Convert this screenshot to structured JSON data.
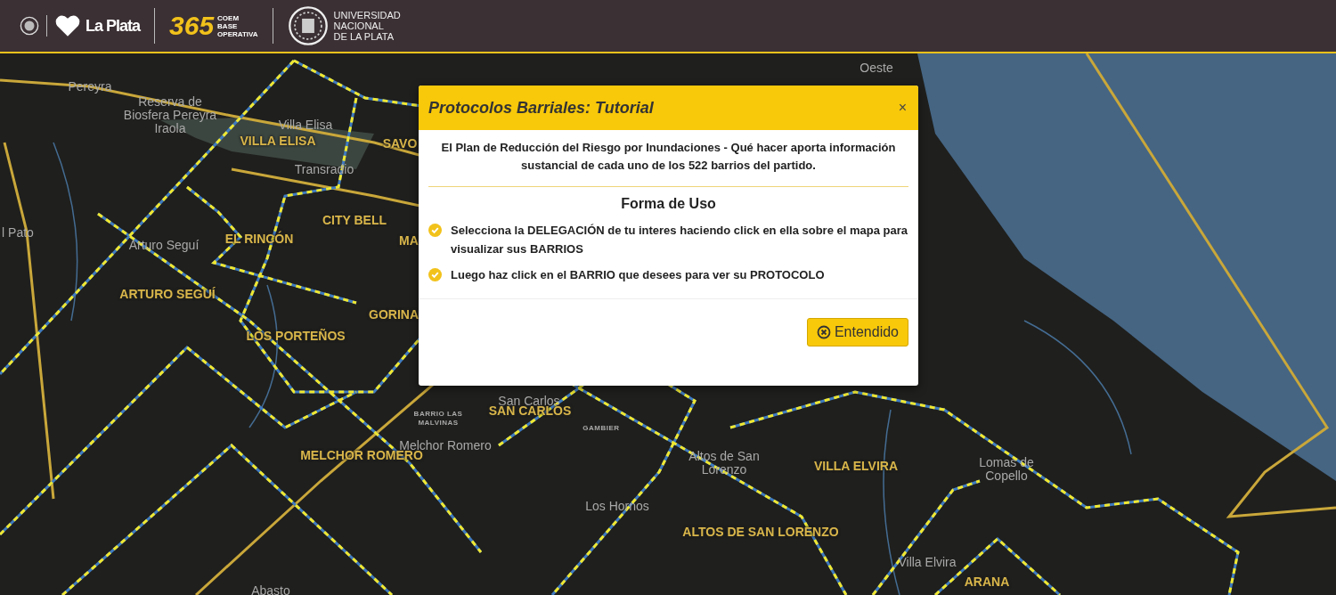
{
  "header": {
    "city_logo": {
      "text": "La Plata"
    },
    "coem_logo": {
      "number": "365",
      "lines": [
        "COEM",
        "BASE",
        "OPERATIVA"
      ]
    },
    "university_logo": {
      "lines": [
        "UNIVERSIDAD",
        "NACIONAL",
        "DE LA PLATA"
      ]
    }
  },
  "map": {
    "labels": [
      {
        "kind": "place",
        "text": "Oeste"
      },
      {
        "kind": "place",
        "text": "Pereyra"
      },
      {
        "kind": "place",
        "text": "Reserva de Biosfera Pereyra Iraola"
      },
      {
        "kind": "place",
        "text": "Villa Elisa"
      },
      {
        "kind": "delegation",
        "text": "VILLA ELISA"
      },
      {
        "kind": "delegation",
        "text": "SAVO"
      },
      {
        "kind": "place",
        "text": "Transradio"
      },
      {
        "kind": "delegation",
        "text": "CITY BELL"
      },
      {
        "kind": "place",
        "text": "l Pato"
      },
      {
        "kind": "place",
        "text": "Arturo Seguí"
      },
      {
        "kind": "delegation",
        "text": "EL RINCÓN"
      },
      {
        "kind": "delegation",
        "text": "MA"
      },
      {
        "kind": "delegation",
        "text": "ARTURO SEGUÍ"
      },
      {
        "kind": "delegation",
        "text": "GORINA"
      },
      {
        "kind": "delegation",
        "text": "LOS PORTEÑOS"
      },
      {
        "kind": "place",
        "text": "San Carlos"
      },
      {
        "kind": "small",
        "text": "BARRIO LAS MALVINAS"
      },
      {
        "kind": "delegation",
        "text": "SAN CARLOS"
      },
      {
        "kind": "small",
        "text": "GAMBIER"
      },
      {
        "kind": "delegation",
        "text": "MELCHOR ROMERO"
      },
      {
        "kind": "place",
        "text": "Melchor Romero"
      },
      {
        "kind": "place",
        "text": "Altos de San Lorenzo"
      },
      {
        "kind": "delegation",
        "text": "VILLA ELVIRA"
      },
      {
        "kind": "place",
        "text": "Lomas de Copello"
      },
      {
        "kind": "place",
        "text": "Los Hornos"
      },
      {
        "kind": "delegation",
        "text": "ALTOS DE SAN LORENZO"
      },
      {
        "kind": "place",
        "text": "Villa Elvira"
      },
      {
        "kind": "delegation",
        "text": "ARANA"
      },
      {
        "kind": "place",
        "text": "Abasto"
      }
    ]
  },
  "modal": {
    "title": "Protocolos Barriales: Tutorial",
    "close": "×",
    "intro": "El Plan de Reducción del Riesgo por Inundaciones - Qué hacer aporta información sustancial de cada uno de los 522 barrios del partido.",
    "heading": "Forma de Uso",
    "steps": [
      "Selecciona la **DELEGACIÓN** de tu interes haciendo click en ella sobre el mapa para visualizar sus **BARRIOS**",
      "Luego haz click en el **BARRIO** que desees para ver su **PROTOCOLO**"
    ],
    "button": "Entendido"
  }
}
